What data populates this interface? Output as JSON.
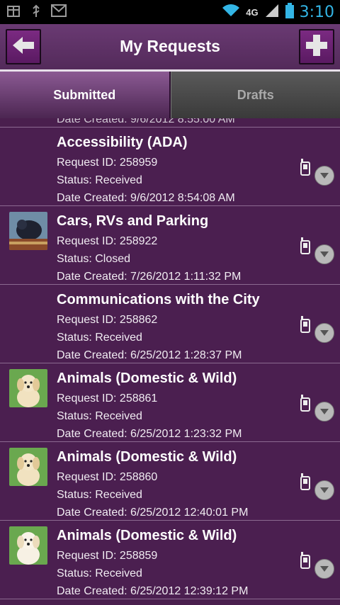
{
  "status_bar": {
    "network": "4G",
    "time": "3:10",
    "left_icons": [
      "box-icon",
      "usb-icon",
      "gmail-icon"
    ]
  },
  "header": {
    "title": "My Requests",
    "back_icon": "arrow-left-icon",
    "add_icon": "plus-icon"
  },
  "tabs": [
    {
      "label": "Submitted",
      "active": true
    },
    {
      "label": "Drafts",
      "active": false
    }
  ],
  "peek_text": "Date Created: 9/6/2012 8:55:00 AM",
  "requests": [
    {
      "title": "Accessibility (ADA)",
      "id_line": "Request ID: 258959",
      "status_line": "Status: Received",
      "date_line": "Date Created: 9/6/2012 8:54:08 AM",
      "thumb": "none"
    },
    {
      "title": "Cars, RVs and Parking",
      "id_line": "Request ID: 258922",
      "status_line": "Status: Closed",
      "date_line": "Date Created: 7/26/2012 1:11:32 PM",
      "thumb": "photo"
    },
    {
      "title": "Communications with the City",
      "id_line": "Request ID: 258862",
      "status_line": "Status: Received",
      "date_line": "Date Created: 6/25/2012 1:28:37 PM",
      "thumb": "none"
    },
    {
      "title": "Animals (Domestic & Wild)",
      "id_line": "Request ID: 258861",
      "status_line": "Status: Received",
      "date_line": "Date Created: 6/25/2012 1:23:32 PM",
      "thumb": "dog"
    },
    {
      "title": "Animals (Domestic & Wild)",
      "id_line": "Request ID: 258860",
      "status_line": "Status: Received",
      "date_line": "Date Created: 6/25/2012 12:40:01 PM",
      "thumb": "dog"
    },
    {
      "title": "Animals (Domestic & Wild)",
      "id_line": "Request ID: 258859",
      "status_line": "Status: Received",
      "date_line": "Date Created: 6/25/2012 12:39:12 PM",
      "thumb": "dog"
    }
  ],
  "colors": {
    "background": "#4a1f4e",
    "accent_time": "#33b5e5",
    "button": "#7b2a82"
  }
}
